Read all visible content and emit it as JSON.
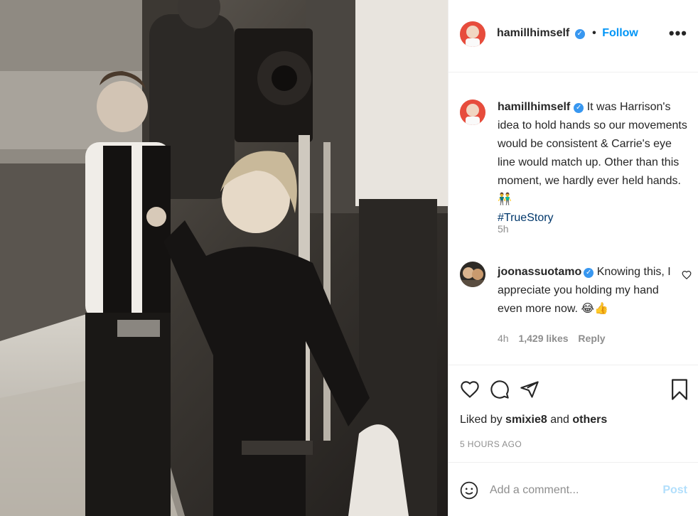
{
  "post": {
    "username": "hamillhimself",
    "follow_label": "Follow",
    "separator": "•",
    "more_label": "•••"
  },
  "caption": {
    "username": "hamillhimself",
    "text": "It was Harrison's idea to hold hands so our movements would be consistent & Carrie's eye line would match up. Other than this moment, we hardly ever held hands. 👬",
    "hashtag": "#TrueStory",
    "time": "5h"
  },
  "reply": {
    "username": "joonassuotamo",
    "text": "Knowing this, I appreciate you holding my hand even more now. 😂👍",
    "time": "4h",
    "likes": "1,429 likes",
    "reply_label": "Reply"
  },
  "likes": {
    "prefix": "Liked by",
    "user": "smixie8",
    "conj": "and",
    "others": "others",
    "posted": "5 HOURS AGO"
  },
  "comment_box": {
    "placeholder": "Add a comment...",
    "post_label": "Post"
  },
  "icons": [
    "heart-icon",
    "comment-icon",
    "share-icon",
    "bookmark-icon",
    "emoji-icon",
    "verified-icon",
    "small-heart-icon"
  ],
  "colors": {
    "accent": "#0095f6",
    "link_dark": "#00376b",
    "muted": "#8e8e8e",
    "verified": "#3897f0"
  }
}
